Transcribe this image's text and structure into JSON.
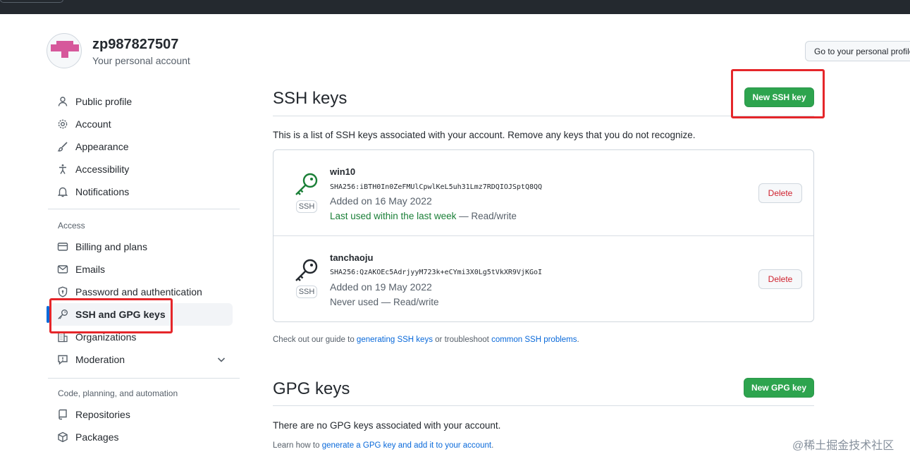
{
  "header": {
    "username": "zp987827507",
    "subtitle": "Your personal account",
    "goto_button": "Go to your personal profile"
  },
  "sidebar": {
    "items_top": [
      {
        "label": "Public profile",
        "icon": "person-icon"
      },
      {
        "label": "Account",
        "icon": "gear-icon"
      },
      {
        "label": "Appearance",
        "icon": "paintbrush-icon"
      },
      {
        "label": "Accessibility",
        "icon": "accessibility-icon"
      },
      {
        "label": "Notifications",
        "icon": "bell-icon"
      }
    ],
    "access_heading": "Access",
    "items_access": [
      {
        "label": "Billing and plans",
        "icon": "credit-card-icon"
      },
      {
        "label": "Emails",
        "icon": "mail-icon"
      },
      {
        "label": "Password and authentication",
        "icon": "shield-lock-icon"
      },
      {
        "label": "SSH and GPG keys",
        "icon": "key-icon",
        "active": true
      },
      {
        "label": "Organizations",
        "icon": "organization-icon"
      },
      {
        "label": "Moderation",
        "icon": "report-icon"
      }
    ],
    "code_heading": "Code, planning, and automation",
    "items_code": [
      {
        "label": "Repositories",
        "icon": "repo-icon"
      },
      {
        "label": "Packages",
        "icon": "package-icon"
      }
    ]
  },
  "ssh": {
    "title": "SSH keys",
    "new_button": "New SSH key",
    "description": "This is a list of SSH keys associated with your account. Remove any keys that you do not recognize.",
    "keys": [
      {
        "title": "win10",
        "fingerprint": "SHA256:iBTH0In0ZeFMUlCpwlKeL5uh31Lmz7RDQIOJSptQ8QQ",
        "added": "Added on 16 May 2022",
        "usage_recent": "Last used within the last week",
        "usage_rest": " — Read/write",
        "tag": "SSH",
        "delete": "Delete"
      },
      {
        "title": "tanchaoju",
        "fingerprint": "SHA256:QzAKOEc5AdrjyyM723k+eCYmi3X0Lg5tVkXR9VjKGoI",
        "added": "Added on 19 May 2022",
        "usage_recent": "",
        "usage_rest": "Never used — Read/write",
        "tag": "SSH",
        "delete": "Delete"
      }
    ],
    "guide": {
      "prefix": "Check out our guide to ",
      "link1": "generating SSH keys",
      "middle": " or troubleshoot ",
      "link2": "common SSH problems",
      "suffix": "."
    }
  },
  "gpg": {
    "title": "GPG keys",
    "new_button": "New GPG key",
    "empty_text": "There are no GPG keys associated with your account.",
    "learn": {
      "prefix": "Learn how to ",
      "link": "generate a GPG key and add it to your account",
      "suffix": "."
    }
  },
  "watermark": "@稀土掘金技术社区",
  "colors": {
    "accent_green": "#2da44e",
    "highlight_red": "#e5262a",
    "link_blue": "#0969da",
    "danger_red": "#cf222e"
  }
}
